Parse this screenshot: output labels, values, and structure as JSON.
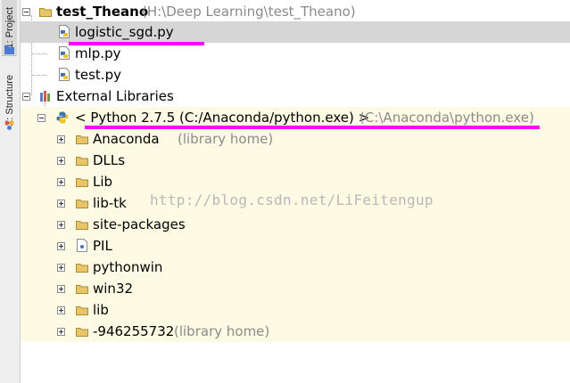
{
  "sidebar": {
    "project_tab": "1: Project",
    "structure_tab": "Z: Structure"
  },
  "tree": {
    "project_name": "test_Theano",
    "project_path": "(H:\\Deep Learning\\test_Theano)",
    "files": [
      "logistic_sgd.py",
      "mlp.py",
      "test.py"
    ],
    "external_libraries": "External Libraries",
    "sdk_name": "< Python 2.7.5 (C:/Anaconda/python.exe) >",
    "sdk_path": "(C:\\Anaconda\\python.exe)",
    "libs": [
      {
        "name": "Anaconda",
        "note": "(library home)"
      },
      {
        "name": "DLLs",
        "note": ""
      },
      {
        "name": "Lib",
        "note": ""
      },
      {
        "name": "lib-tk",
        "note": ""
      },
      {
        "name": "site-packages",
        "note": ""
      },
      {
        "name": "PIL",
        "note": ""
      },
      {
        "name": "pythonwin",
        "note": ""
      },
      {
        "name": "win32",
        "note": ""
      },
      {
        "name": "lib",
        "note": ""
      },
      {
        "name": "-946255732",
        "note": "(library home)"
      }
    ]
  },
  "watermark": "http://blog.csdn.net/LiFeitengup",
  "colors": {
    "selected_row": "#d6d6d6",
    "library_bg": "#fdfbe4",
    "annotation": "#ff00ff",
    "folder": "#e8c46a"
  },
  "icons": [
    "folder-icon",
    "python-file-icon",
    "library-icon",
    "python-sdk-icon"
  ]
}
